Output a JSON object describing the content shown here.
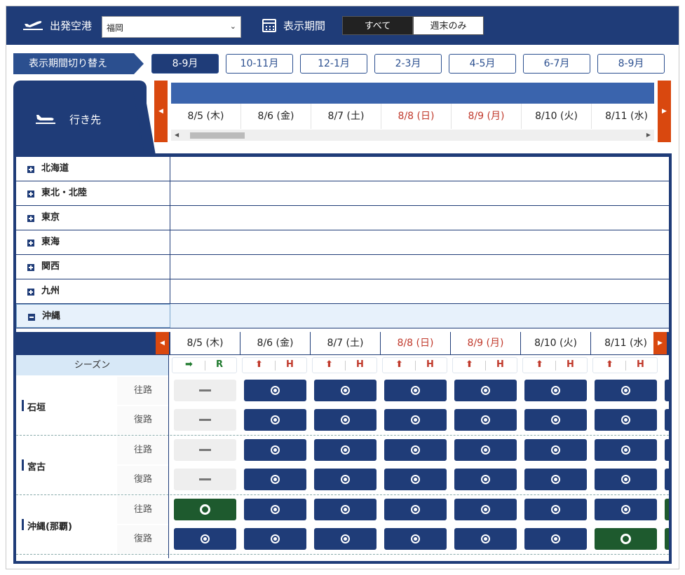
{
  "header": {
    "origin_label": "出発空港",
    "origin_value": "福岡",
    "period_label": "表示期間",
    "toggle_all": "すべて",
    "toggle_weekend": "週末のみ"
  },
  "period": {
    "label": "表示期間切り替え",
    "tabs": [
      "8-9月",
      "10-11月",
      "12-1月",
      "2-3月",
      "4-5月",
      "6-7月",
      "8-9月"
    ],
    "active_index": 0
  },
  "destination_tab": "行き先",
  "dates": [
    {
      "label": "8/5 (木)",
      "holiday": false
    },
    {
      "label": "8/6 (金)",
      "holiday": false
    },
    {
      "label": "8/7 (土)",
      "holiday": false
    },
    {
      "label": "8/8 (日)",
      "holiday": true
    },
    {
      "label": "8/9 (月)",
      "holiday": true
    },
    {
      "label": "8/10 (火)",
      "holiday": false
    },
    {
      "label": "8/11 (水)",
      "holiday": false
    }
  ],
  "regions": [
    {
      "name": "北海道",
      "open": false
    },
    {
      "name": "東北・北陸",
      "open": false
    },
    {
      "name": "東京",
      "open": false
    },
    {
      "name": "東海",
      "open": false
    },
    {
      "name": "関西",
      "open": false
    },
    {
      "name": "九州",
      "open": false
    },
    {
      "name": "沖縄",
      "open": true
    }
  ],
  "season": {
    "label": "シーズン",
    "codes": [
      {
        "arrow": "➡",
        "letter": "R",
        "color": "green"
      },
      {
        "arrow": "⬆",
        "letter": "H",
        "color": "red"
      },
      {
        "arrow": "⬆",
        "letter": "H",
        "color": "red"
      },
      {
        "arrow": "⬆",
        "letter": "H",
        "color": "red"
      },
      {
        "arrow": "⬆",
        "letter": "H",
        "color": "red"
      },
      {
        "arrow": "⬆",
        "letter": "H",
        "color": "red"
      },
      {
        "arrow": "⬆",
        "letter": "H",
        "color": "red"
      }
    ]
  },
  "directions": {
    "out": "往路",
    "back": "復路"
  },
  "destinations": [
    {
      "name": "石垣",
      "out": [
        "none",
        "on",
        "on",
        "on",
        "on",
        "on",
        "on"
      ],
      "back": [
        "none",
        "on",
        "on",
        "on",
        "on",
        "on",
        "on"
      ],
      "tail": "on"
    },
    {
      "name": "宮古",
      "out": [
        "none",
        "on",
        "on",
        "on",
        "on",
        "on",
        "on"
      ],
      "back": [
        "none",
        "on",
        "on",
        "on",
        "on",
        "on",
        "on"
      ],
      "tail": "on"
    },
    {
      "name": "沖縄(那覇)",
      "out": [
        "top",
        "on",
        "on",
        "on",
        "on",
        "on",
        "on"
      ],
      "back": [
        "on",
        "on",
        "on",
        "on",
        "on",
        "on",
        "top"
      ],
      "tail": "top"
    }
  ],
  "colors": {
    "navy": "#1f3c78",
    "accent": "#d9480f",
    "holiday": "#c0392b",
    "top_status": "#1e5a2e"
  }
}
